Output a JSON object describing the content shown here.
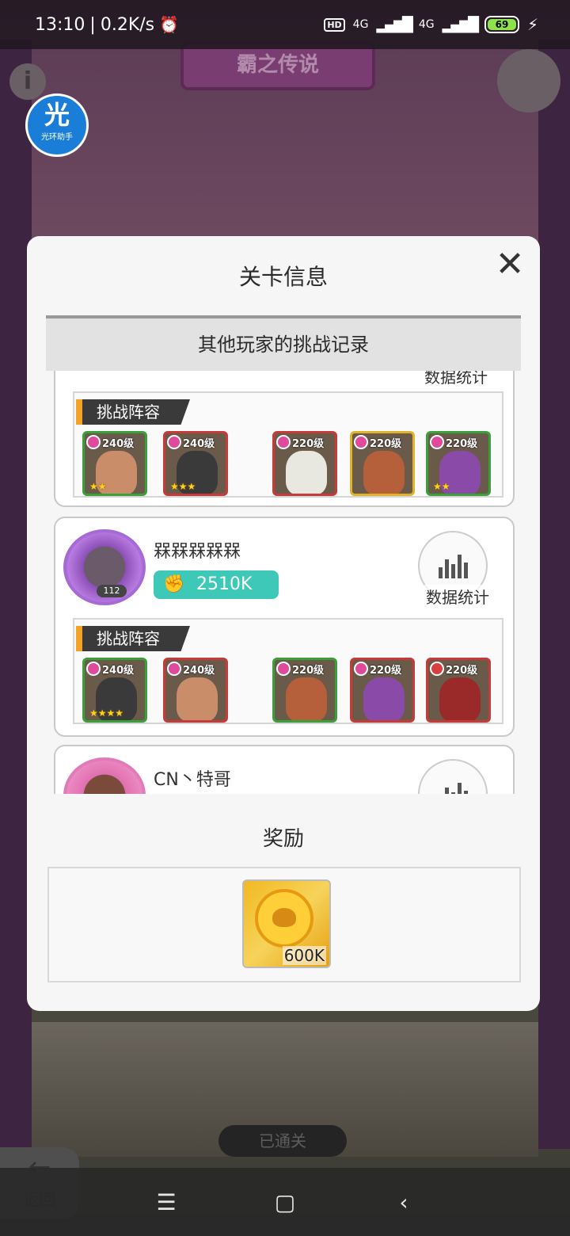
{
  "status_bar": {
    "time": "13:10",
    "speed": "0.2K/s",
    "separator": "|",
    "battery": "69",
    "net1": "4G",
    "net2": "4G",
    "hd": "HD"
  },
  "background": {
    "title": "霸之传说",
    "passed_label": "已通关",
    "back_label": "返回"
  },
  "assistant": {
    "glyph": "光",
    "name": "光环助手"
  },
  "modal": {
    "title": "关卡信息",
    "close_glyph": "✕",
    "tab_title": "其他玩家的挑战记录",
    "records": [
      {
        "player_name": "",
        "power": "",
        "stats_label": "数据统计",
        "lineup_label": "挑战阵容",
        "heroes": [
          {
            "level": "240级",
            "stars": "★★",
            "frame": "green"
          },
          {
            "level": "240级",
            "stars": "★★★",
            "frame": "red"
          },
          {
            "level": "220级",
            "stars": "",
            "frame": "red"
          },
          {
            "level": "220级",
            "stars": "",
            "frame": "gold"
          },
          {
            "level": "220级",
            "stars": "★★",
            "frame": "green"
          }
        ]
      },
      {
        "player_name": "槑槑槑槑槑",
        "avatar_level": "112",
        "power": "2510K",
        "stats_label": "数据统计",
        "lineup_label": "挑战阵容",
        "heroes": [
          {
            "level": "240级",
            "stars": "★★★★",
            "frame": "green"
          },
          {
            "level": "240级",
            "stars": "",
            "frame": "red"
          },
          {
            "level": "220级",
            "stars": "",
            "frame": "green"
          },
          {
            "level": "220级",
            "stars": "",
            "frame": "red"
          },
          {
            "level": "220级",
            "stars": "",
            "frame": "red"
          }
        ]
      },
      {
        "player_name": "CN丶特哥"
      }
    ],
    "reward_title": "奖励",
    "reward_amount": "600K"
  },
  "colors": {
    "power_badge": "#3ec8b8",
    "lineup_accent": "#f3a326"
  }
}
